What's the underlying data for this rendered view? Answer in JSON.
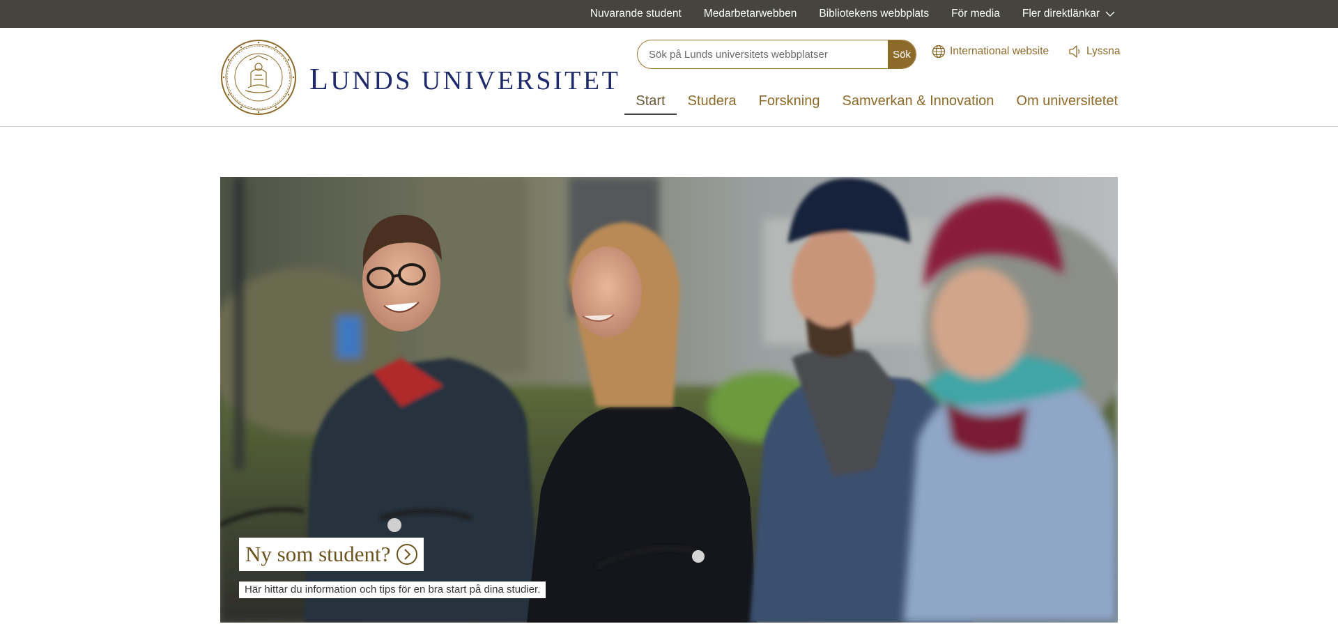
{
  "topbar": {
    "links": [
      {
        "label": "Nuvarande student"
      },
      {
        "label": "Medarbetarwebben"
      },
      {
        "label": "Bibliotekens webbplats"
      },
      {
        "label": "För media"
      },
      {
        "label": "Fler direktlänkar",
        "icon": "chevron-down-icon"
      }
    ]
  },
  "header": {
    "logo": {
      "text_first": "L",
      "text_rest": "UNDS UNIVERSITET",
      "seal_icon": "university-seal-icon"
    },
    "search": {
      "placeholder": "Sök på Lunds universitets webbplatser",
      "button_label": "Sök"
    },
    "international": {
      "label": "International website",
      "icon": "globe-icon"
    },
    "listen": {
      "label": "Lyssna",
      "icon": "speaker-icon"
    },
    "nav": {
      "items": [
        {
          "label": "Start",
          "active": true
        },
        {
          "label": "Studera"
        },
        {
          "label": "Forskning"
        },
        {
          "label": "Samverkan & Innovation"
        },
        {
          "label": "Om universitetet"
        }
      ]
    }
  },
  "hero": {
    "title": "Ny som student?",
    "title_icon": "circle-arrow-right-icon",
    "subtitle": "Här hittar du information och tips för en bra start på dina studier."
  },
  "colors": {
    "topbar_bg": "#45443f",
    "brand_gold": "#8c6a2a",
    "logo_blue": "#1f2a6b"
  }
}
